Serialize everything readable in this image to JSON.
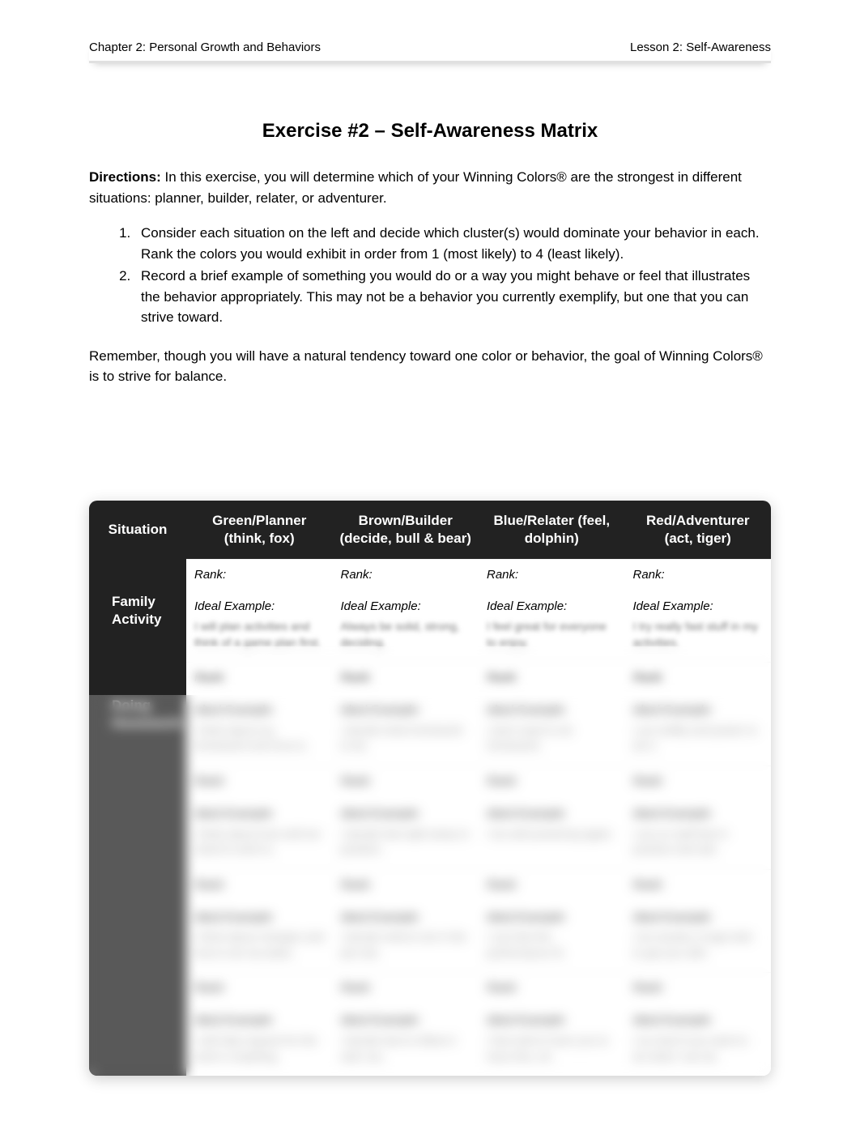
{
  "header": {
    "left": "Chapter 2: Personal Growth and Behaviors",
    "right": "Lesson 2: Self-Awareness"
  },
  "title": "Exercise #2 – Self-Awareness Matrix",
  "directions_label": "Directions:",
  "directions_text": " In this exercise, you will determine which of your Winning Colors® are the strongest in different situations: planner, builder, relater, or adventurer.",
  "steps": [
    "Consider each situation on the left and decide which cluster(s) would dominate your behavior in each. Rank the colors you would exhibit in order from 1 (most likely) to 4 (least likely).",
    "Record a brief example of something you would do or a way you might behave or feel that illustrates the behavior appropriately. This may not be a behavior you currently exemplify, but one that you can strive toward."
  ],
  "remember": "Remember, though you will have a natural tendency toward one color or behavior, the goal of Winning Colors® is to strive for balance.",
  "table": {
    "headers": {
      "situation": "Situation",
      "green": "Green/Planner (think, fox)",
      "brown": "Brown/Builder (decide, bull & bear)",
      "blue": "Blue/Relater (feel, dolphin)",
      "red": "Red/Adventurer (act, tiger)"
    },
    "rank_label": "Rank:",
    "ideal_label": "Ideal Example:",
    "rows": [
      {
        "situation": "Family Activity",
        "cells": [
          "",
          "",
          "",
          ""
        ]
      },
      {
        "situation": "Doing Homework",
        "cells": [
          "",
          "",
          "",
          ""
        ]
      },
      {
        "situation": "",
        "cells": [
          "",
          "",
          "",
          ""
        ]
      },
      {
        "situation": "",
        "cells": [
          "",
          "",
          "",
          ""
        ]
      },
      {
        "situation": "",
        "cells": [
          "",
          "",
          "",
          ""
        ]
      }
    ]
  },
  "footer_blur_left": "",
  "footer_blur_right": ""
}
